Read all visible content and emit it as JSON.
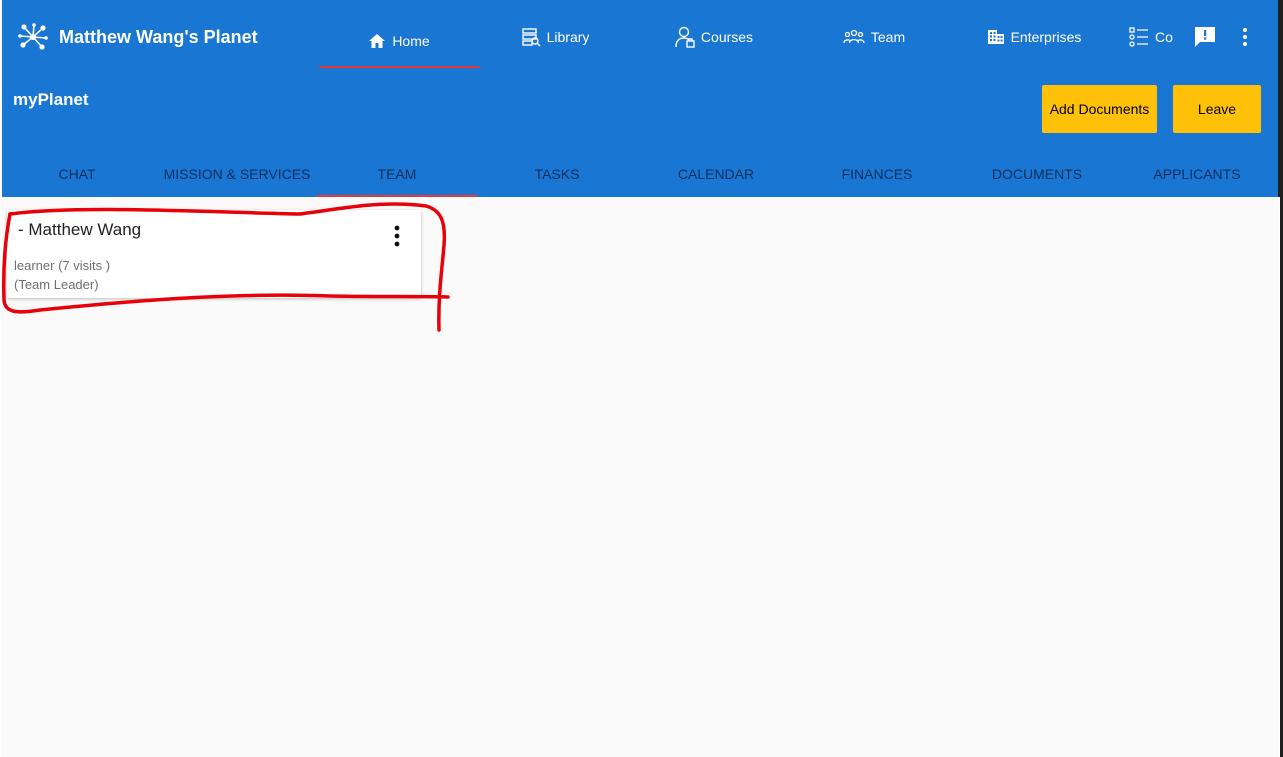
{
  "app": {
    "title": "Matthew Wang's Planet"
  },
  "nav": {
    "items": [
      {
        "label": "Home",
        "icon": "home-icon"
      },
      {
        "label": "Library",
        "icon": "library-icon"
      },
      {
        "label": "Courses",
        "icon": "courses-icon"
      },
      {
        "label": "Team",
        "icon": "team-icon"
      },
      {
        "label": "Enterprises",
        "icon": "enterprises-icon"
      },
      {
        "label": "Co",
        "icon": "checklist-icon"
      }
    ],
    "active": "Home"
  },
  "team": {
    "title": "myPlanet",
    "add_documents_label": "Add Documents",
    "leave_label": "Leave"
  },
  "tabs": [
    "CHAT",
    "MISSION & SERVICES",
    "TEAM",
    "TASKS",
    "CALENDAR",
    "FINANCES",
    "DOCUMENTS",
    "APPLICANTS"
  ],
  "active_tab": "TEAM",
  "members": [
    {
      "name": "- Matthew Wang",
      "role": "learner (7 visits )",
      "leader": "(Team Leader)"
    }
  ],
  "colors": {
    "primary": "#1976d2",
    "accent": "#ffc107",
    "indicator": "#e53935",
    "annotation": "#e8000b"
  }
}
